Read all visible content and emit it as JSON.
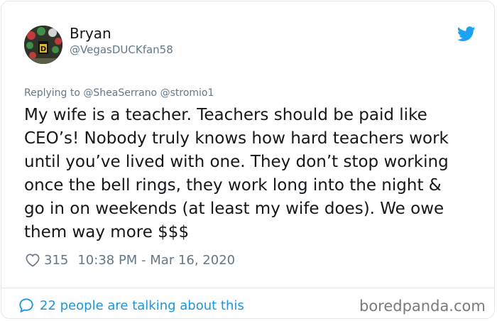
{
  "tweet": {
    "author_name": "Bryan",
    "author_handle": "@VegasDUCKfan58",
    "reply_prefix": "Replying to",
    "reply_mentions": [
      "@SheaSerrano",
      "@stromio1"
    ],
    "body_lines": [
      "My wife is a teacher. Teachers should be paid like",
      "CEO’s! Nobody truly knows how hard teachers work",
      "until you’ve lived with one. They don’t stop working",
      "once the bell rings, they work long into the night &",
      "go in on weekends (at least my wife does). We owe",
      "them way more $$$"
    ],
    "likes": "315",
    "timestamp": "10:38 PM - Mar 16, 2020",
    "talking": "22 people are talking about this"
  },
  "watermark": "boredpanda.com",
  "icons": {
    "twitter": "twitter-bird-icon",
    "like": "heart-icon",
    "conversation": "speech-bubble-icon"
  },
  "colors": {
    "twitter_blue": "#1da1f2",
    "link_blue": "#1b95e0",
    "text_primary": "#14171a",
    "text_secondary": "#657786",
    "border": "#e1e8ed"
  }
}
